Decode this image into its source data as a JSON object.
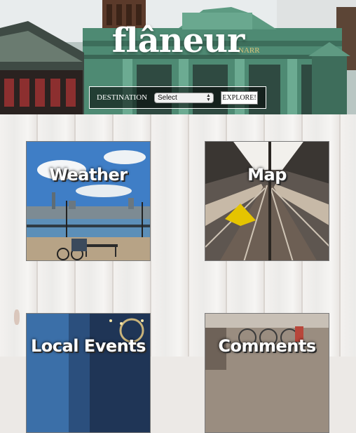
{
  "header": {
    "brand": "flâneur",
    "destination_label": "DESTINATION",
    "destination_select": {
      "selected": "Select"
    },
    "explore_label": "EXPLORE!"
  },
  "tiles": [
    {
      "title": "Weather"
    },
    {
      "title": "Map"
    },
    {
      "title": "Local Events"
    },
    {
      "title": "Comments"
    }
  ],
  "colors": {
    "hero_green": "#4f8b74",
    "box_bg": "#000000",
    "text": "#ffffff"
  },
  "icons": {
    "select_arrows": "up-down-chevron-icon"
  }
}
